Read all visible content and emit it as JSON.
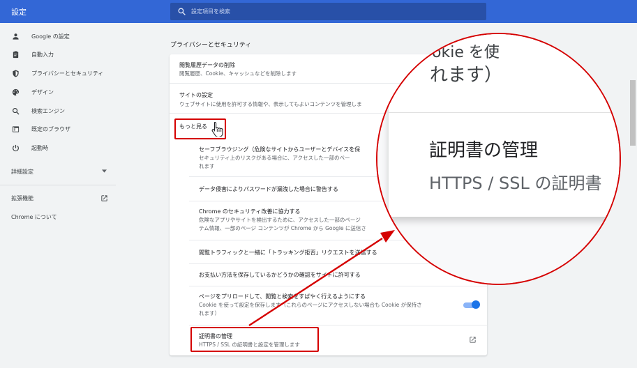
{
  "header": {
    "title": "設定",
    "search_placeholder": "設定項目を検索"
  },
  "sidebar": {
    "items": [
      {
        "label": "Google の設定",
        "icon": "person-icon"
      },
      {
        "label": "自動入力",
        "icon": "clipboard-icon"
      },
      {
        "label": "プライバシーとセキュリティ",
        "icon": "shield-icon"
      },
      {
        "label": "デザイン",
        "icon": "palette-icon"
      },
      {
        "label": "検索エンジン",
        "icon": "search-icon"
      },
      {
        "label": "既定のブラウザ",
        "icon": "browser-icon"
      },
      {
        "label": "起動時",
        "icon": "power-icon"
      }
    ],
    "advanced": "詳細設定",
    "extensions": "拡張機能",
    "about": "Chrome について"
  },
  "main": {
    "section_title": "プライバシーとセキュリティ",
    "rows": {
      "clear_title": "閲覧履歴データの削除",
      "clear_desc": "閲覧履歴、Cookie、キャッシュなどを削除します",
      "site_title": "サイトの設定",
      "site_desc": "ウェブサイトに使用を許可する情報や、表示してもよいコンテンツを管理しま",
      "more": "もっと見る",
      "safe_title": "セーフブラウジング（危険なサイトからユーザーとデバイスを保",
      "safe_desc1": "セキュリティ上のリスクがある場合に、アクセスした一部のペー",
      "safe_desc2": "れます",
      "leak_title": "データ侵害によりパスワードが漏洩した場合に警告する",
      "improve_title": "Chrome のセキュリティ改善に協力する",
      "improve_desc1": "危険なアプリやサイトを検出するために、アクセスした一部のページ",
      "improve_desc2": "テム情報、一部のページ コンテンツが Chrome から Google に送信さ",
      "dnt_title": "閲覧トラフィックと一緒に「トラッキング拒否」リクエストを送信する",
      "payment_title": "お支払い方法を保存しているかどうかの確認をサイトに許可する",
      "preload_title": "ページをプリロードして、閲覧と検索をすばやく行えるようにする",
      "preload_desc1": "Cookie を使って設定を保存します（これらのページにアクセスしない場合も Cookie が保持さ",
      "preload_desc2": "れます）",
      "cert_title": "証明書の管理",
      "cert_desc": "HTTPS / SSL の証明書と設定を管理します"
    }
  },
  "magnifier": {
    "line0": "okie を使",
    "line1": "れます）",
    "line2": "証明書の管理",
    "line3": "HTTPS / SSL の証明書"
  },
  "colors": {
    "header": "#3367d6",
    "highlight": "#d50000",
    "toggle": "#1a73e8"
  }
}
